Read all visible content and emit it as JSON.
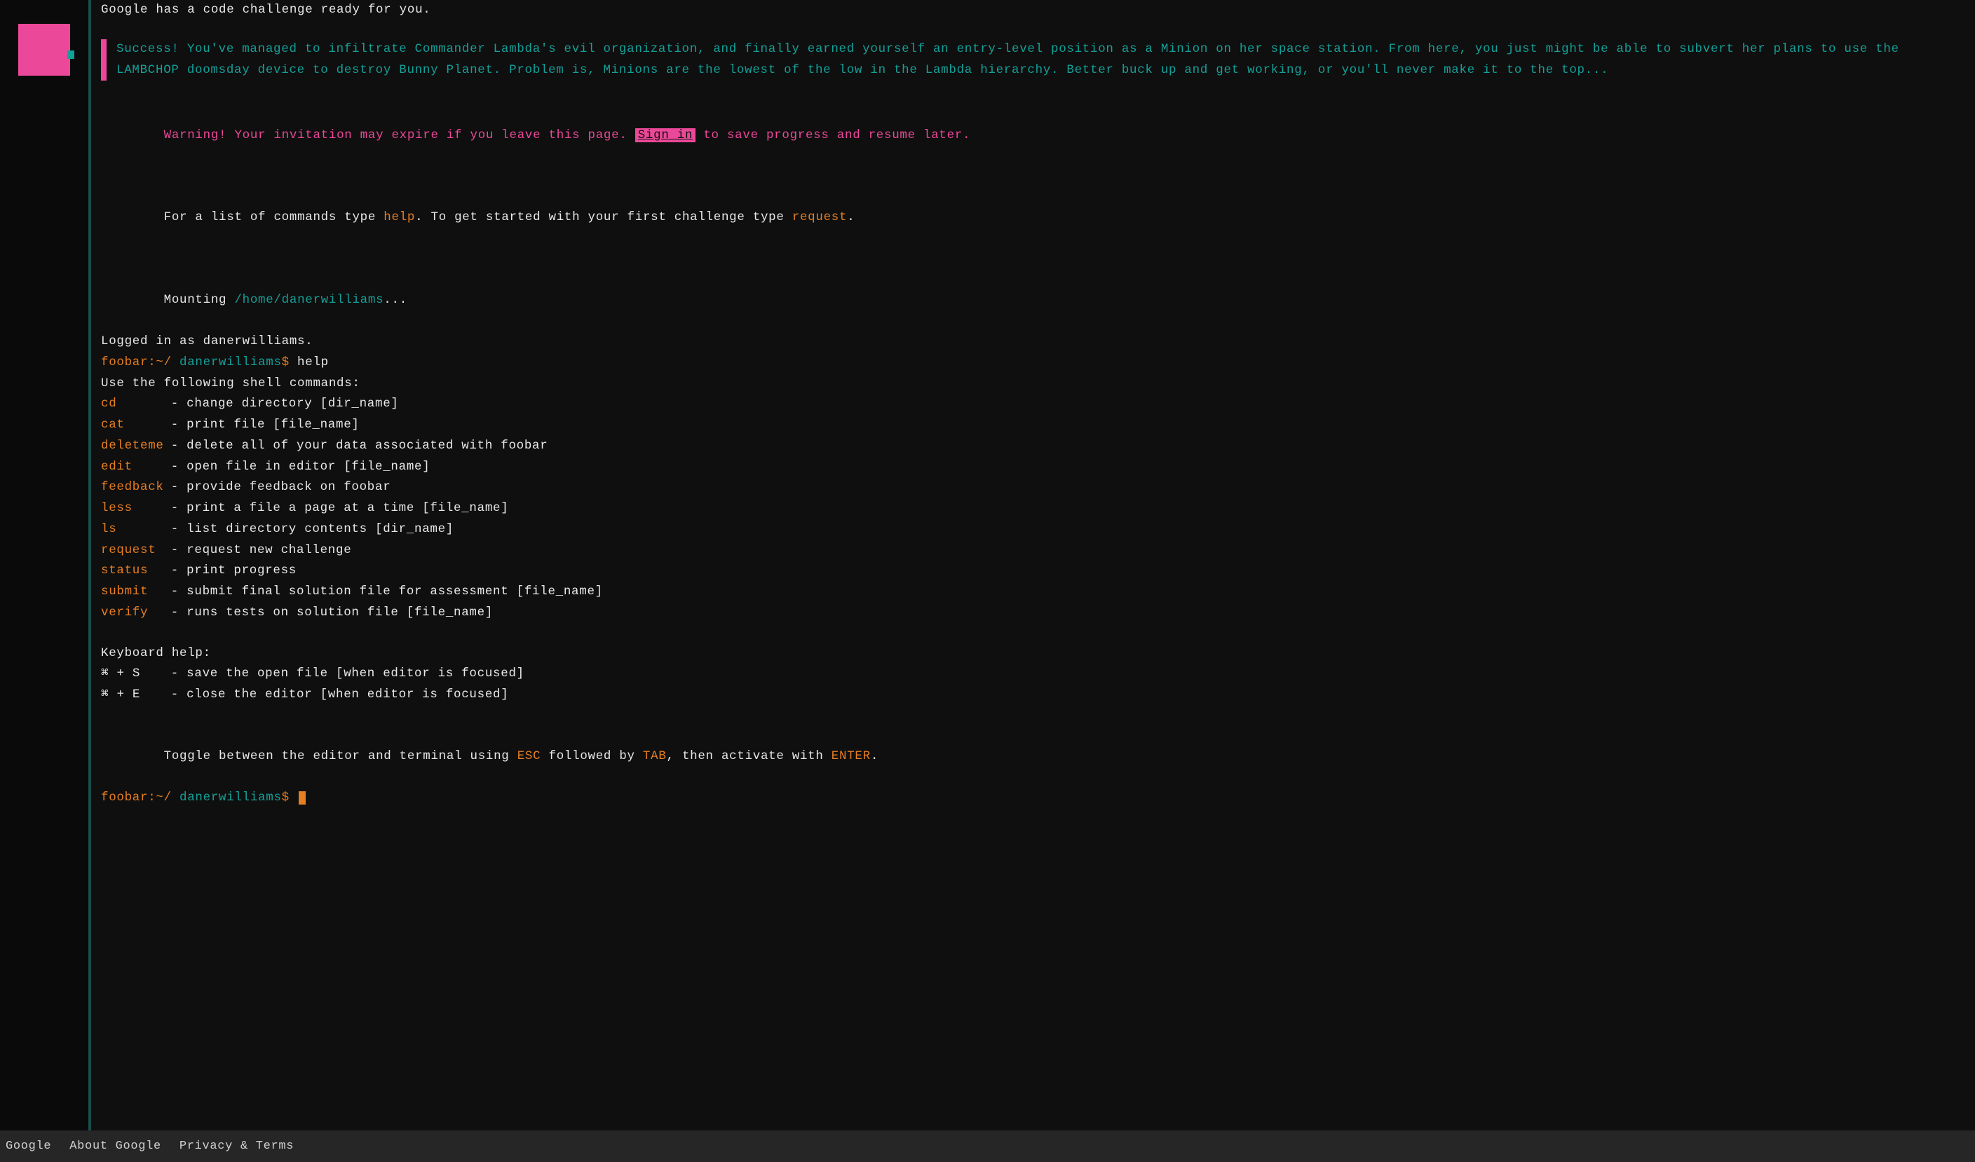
{
  "intro_line": "Google has a code challenge ready for you.",
  "success_block": "Success! You've managed to infiltrate Commander Lambda's evil organization, and finally earned yourself an entry-level position as a Minion on her space station. From here, you just might be able to subvert her plans to use the LAMBCHOP doomsday device to destroy Bunny Planet. Problem is, Minions are the lowest of the low in the Lambda hierarchy. Better buck up and get working, or you'll never make it to the top...",
  "warning": {
    "pre": "Warning! Your invitation may expire if you leave this page. ",
    "signin": "Sign in",
    "post": " to save progress and resume later."
  },
  "instructions": {
    "pre": "For a list of commands type ",
    "help": "help",
    "mid": ". To get started with your first challenge type ",
    "request": "request",
    "end": "."
  },
  "mounting": {
    "pre": "Mounting ",
    "path": "/home/danerwilliams",
    "post": "..."
  },
  "logged_in": "Logged in as danerwilliams.",
  "prompt": {
    "host": "foobar:~/ ",
    "user": "danerwilliams",
    "dollar": "$",
    "first_cmd": " help"
  },
  "help_header": "Use the following shell commands:",
  "commands": [
    {
      "name": "cd",
      "desc": "- change directory [dir_name]"
    },
    {
      "name": "cat",
      "desc": "- print file [file_name]"
    },
    {
      "name": "deleteme",
      "desc": "- delete all of your data associated with foobar"
    },
    {
      "name": "edit",
      "desc": "- open file in editor [file_name]"
    },
    {
      "name": "feedback",
      "desc": "- provide feedback on foobar"
    },
    {
      "name": "less",
      "desc": "- print a file a page at a time [file_name]"
    },
    {
      "name": "ls",
      "desc": "- list directory contents [dir_name]"
    },
    {
      "name": "request",
      "desc": "- request new challenge"
    },
    {
      "name": "status",
      "desc": "- print progress"
    },
    {
      "name": "submit",
      "desc": "- submit final solution file for assessment [file_name]"
    },
    {
      "name": "verify",
      "desc": "- runs tests on solution file [file_name]"
    }
  ],
  "keyboard_header": "Keyboard help:",
  "keyboard": [
    {
      "name": "⌘ + S",
      "desc": "- save the open file [when editor is focused]"
    },
    {
      "name": "⌘ + E",
      "desc": "- close the editor [when editor is focused]"
    }
  ],
  "toggle": {
    "pre": "Toggle between the editor and terminal using ",
    "esc": "ESC",
    "mid": " followed by ",
    "tab": "TAB",
    "mid2": ", then activate with ",
    "enter": "ENTER",
    "end": "."
  },
  "footer": {
    "google": "Google",
    "about": "About Google",
    "privacy": "Privacy & Terms"
  },
  "colors": {
    "accent_pink": "#ec4899",
    "accent_cyan": "#14a098",
    "accent_orange": "#e67e22",
    "bg": "#0f0f0f",
    "footer_bg": "#262626"
  }
}
